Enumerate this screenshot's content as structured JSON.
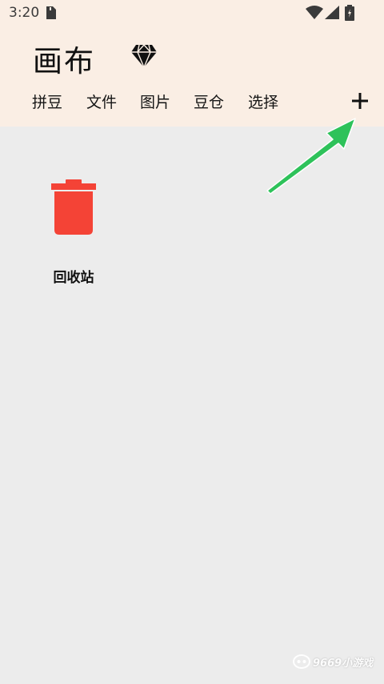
{
  "status_bar": {
    "time": "3:20"
  },
  "app": {
    "title": "画布"
  },
  "tabs": [
    {
      "label": "拼豆"
    },
    {
      "label": "文件"
    },
    {
      "label": "图片"
    },
    {
      "label": "豆仓"
    },
    {
      "label": "选择"
    }
  ],
  "items": [
    {
      "label": "回收站",
      "icon": "trash-icon"
    }
  ],
  "watermark": {
    "text": "9669小游戏"
  },
  "colors": {
    "header_bg": "#faeee4",
    "body_bg": "#ececec",
    "trash_red": "#f44336",
    "arrow_green": "#2ec25a"
  }
}
